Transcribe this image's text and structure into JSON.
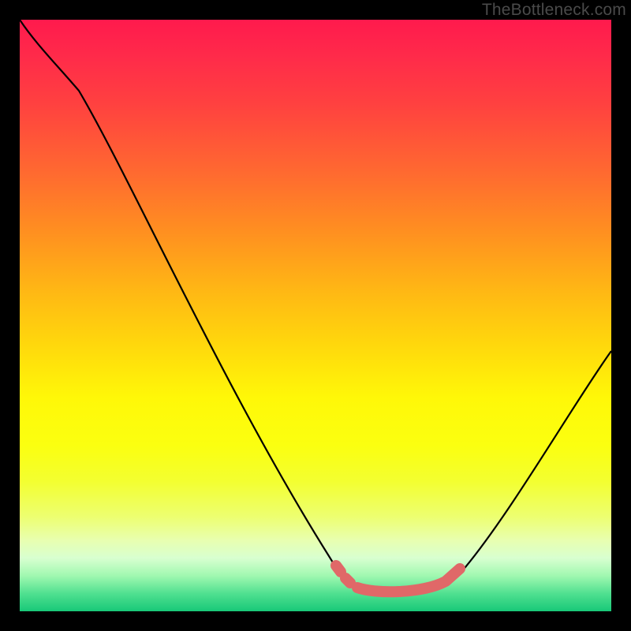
{
  "watermark": "TheBottleneck.com",
  "chart_data": {
    "type": "line",
    "title": "",
    "xlabel": "",
    "ylabel": "",
    "xlim": [
      0,
      100
    ],
    "ylim": [
      0,
      100
    ],
    "series": [
      {
        "name": "bottleneck-curve",
        "x": [
          0,
          5,
          12,
          20,
          28,
          36,
          44,
          50,
          55,
          58,
          62,
          68,
          74,
          80,
          88,
          95,
          100
        ],
        "values": [
          100,
          97,
          90,
          78,
          64,
          49,
          33,
          20,
          11,
          6,
          3,
          3,
          4,
          8,
          18,
          30,
          40
        ]
      },
      {
        "name": "highlight-segment",
        "x": [
          54,
          56,
          58,
          60,
          64,
          68,
          71,
          73,
          74.5
        ],
        "values": [
          7.5,
          5.5,
          4,
          3.2,
          3,
          3,
          3.8,
          5.2,
          6.5
        ]
      }
    ],
    "colors": {
      "curve": "#000000",
      "highlight": "#e06868"
    }
  }
}
